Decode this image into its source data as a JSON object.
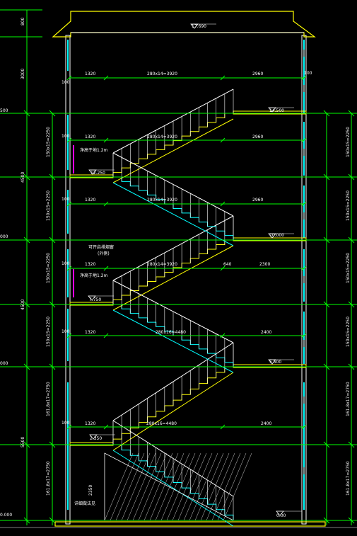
{
  "drawing": {
    "roof_elevation": "17.690",
    "floor_elevations": [
      "14.500",
      "12.250",
      "10.000",
      "7.750",
      "5.500",
      "2.350",
      "0.00"
    ],
    "left_story_dims": [
      "800",
      "3000",
      "4500",
      "4500",
      "5500"
    ],
    "left_story_levels": [
      "500",
      "000",
      "000"
    ],
    "left_flight_dims": [
      "150x15=2250",
      "150x15=2250",
      "150x15=2250",
      "150x15=2250",
      "161.8x17=2750",
      "161.8x17=2750"
    ],
    "right_flight_dims": [
      "150x15=2250",
      "150x15=2250",
      "150x15=2250",
      "150x15=2250",
      "161.8x17=2750",
      "161.8x17=2750"
    ],
    "horizontal_dims": [
      {
        "left": "1320",
        "mid": "280x14=3920",
        "right": "2960"
      },
      {
        "left": "1320",
        "mid": "280x14=3920",
        "right": "2960"
      },
      {
        "left": "1320",
        "mid": "280x14=3920",
        "right": "2960"
      },
      {
        "left": "1320",
        "mid": "280x14=3920",
        "right2": "640",
        "right": "2300"
      },
      {
        "left": "1320",
        "mid": "280x16=4480",
        "right": "2400"
      },
      {
        "left": "1320",
        "mid": "280x16=4480",
        "right": "2400"
      }
    ],
    "small_dims": [
      "100",
      "100",
      "100",
      "100",
      "100",
      "100",
      "100"
    ],
    "notes": {
      "window_sill_1": "净高于地1.2m",
      "window_sill_2": "净高于地1.2m",
      "smoke_vent": "可开启排烟窗",
      "smoke_vent_sub": "(外侧)",
      "ground_note": "详细做法见",
      "dim_2350": "2350"
    }
  }
}
